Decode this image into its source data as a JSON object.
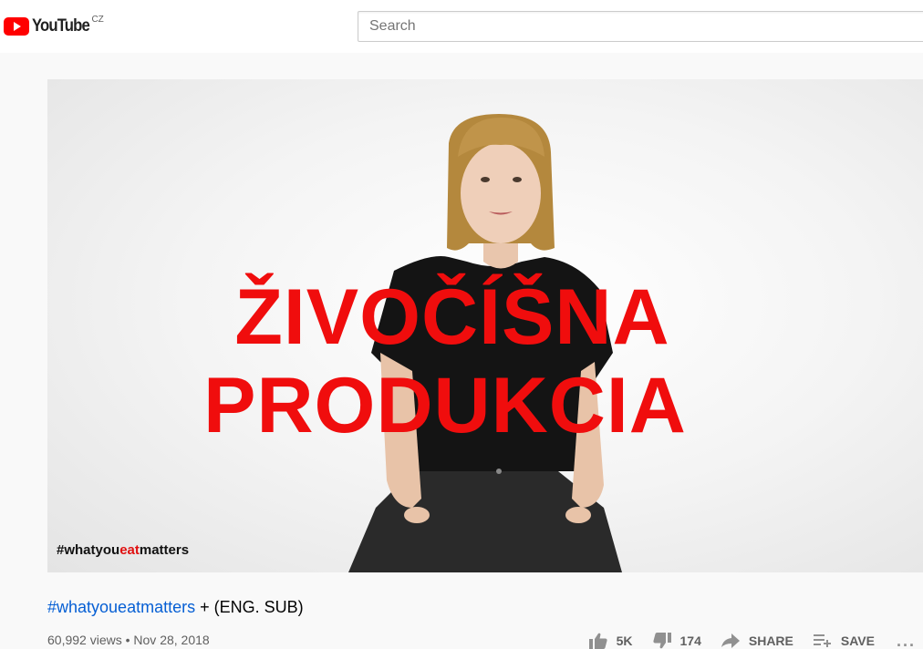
{
  "header": {
    "logo_text": "YouTube",
    "country_code": "CZ",
    "search_placeholder": "Search"
  },
  "video": {
    "overlay_line1": "ŽIVOČÍŠNA",
    "overlay_line2": "PRODUKCIA",
    "overlay_hashtag_prefix": "#whatyou",
    "overlay_hashtag_highlight": "eat",
    "overlay_hashtag_suffix": "matters"
  },
  "info": {
    "title_hashtag": "#whatyoueatmatters",
    "title_rest": " + (ENG. SUB)",
    "views": "60,992 views",
    "separator": " • ",
    "date": "Nov 28, 2018"
  },
  "actions": {
    "likes": "5K",
    "dislikes": "174",
    "share_label": "SHARE",
    "save_label": "SAVE",
    "more_label": "..."
  },
  "icons": {
    "logo": "youtube-play-icon",
    "like": "thumbs-up-icon",
    "dislike": "thumbs-down-icon",
    "share": "share-arrow-icon",
    "save": "playlist-add-icon",
    "more": "more-horizontal-icon"
  },
  "colors": {
    "brand_red": "#ff0000",
    "link_blue": "#065fd4",
    "overlay_red": "#f00d0d"
  }
}
